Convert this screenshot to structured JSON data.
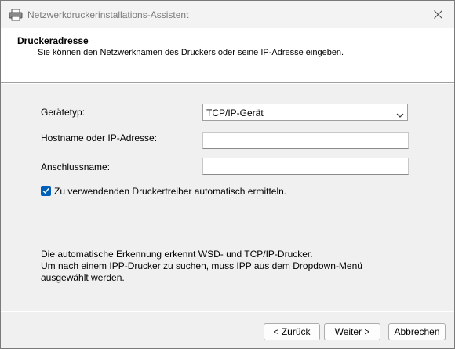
{
  "window": {
    "title": "Netzwerkdruckerinstallations-Assistent"
  },
  "header": {
    "title": "Druckeradresse",
    "subtitle": "Sie können den Netzwerknamen des Druckers oder seine IP-Adresse eingeben."
  },
  "form": {
    "device_type_label": "Gerätetyp:",
    "device_type_value": "TCP/IP-Gerät",
    "hostname_label": "Hostname oder IP-Adresse:",
    "hostname_value": "",
    "port_label": "Anschlussname:",
    "port_value": "",
    "auto_detect_label": "Zu verwendenden Druckertreiber automatisch ermitteln.",
    "auto_detect_checked": true
  },
  "info": {
    "line1": "Die automatische Erkennung erkennt WSD- und TCP/IP-Drucker.",
    "line2": "Um nach einem IPP-Drucker zu suchen, muss IPP aus dem Dropdown-Menü",
    "line3": "ausgewählt werden."
  },
  "buttons": {
    "back": "< Zurück",
    "next": "Weiter >",
    "cancel": "Abbrechen"
  },
  "colors": {
    "accent": "#005fb8",
    "dialog_bg": "#f0f0f0",
    "header_bg": "#ffffff"
  },
  "icons": {
    "window_icon": "printer-icon",
    "close": "close-icon",
    "dropdown": "chevron-down-icon",
    "check": "checkmark-icon"
  }
}
